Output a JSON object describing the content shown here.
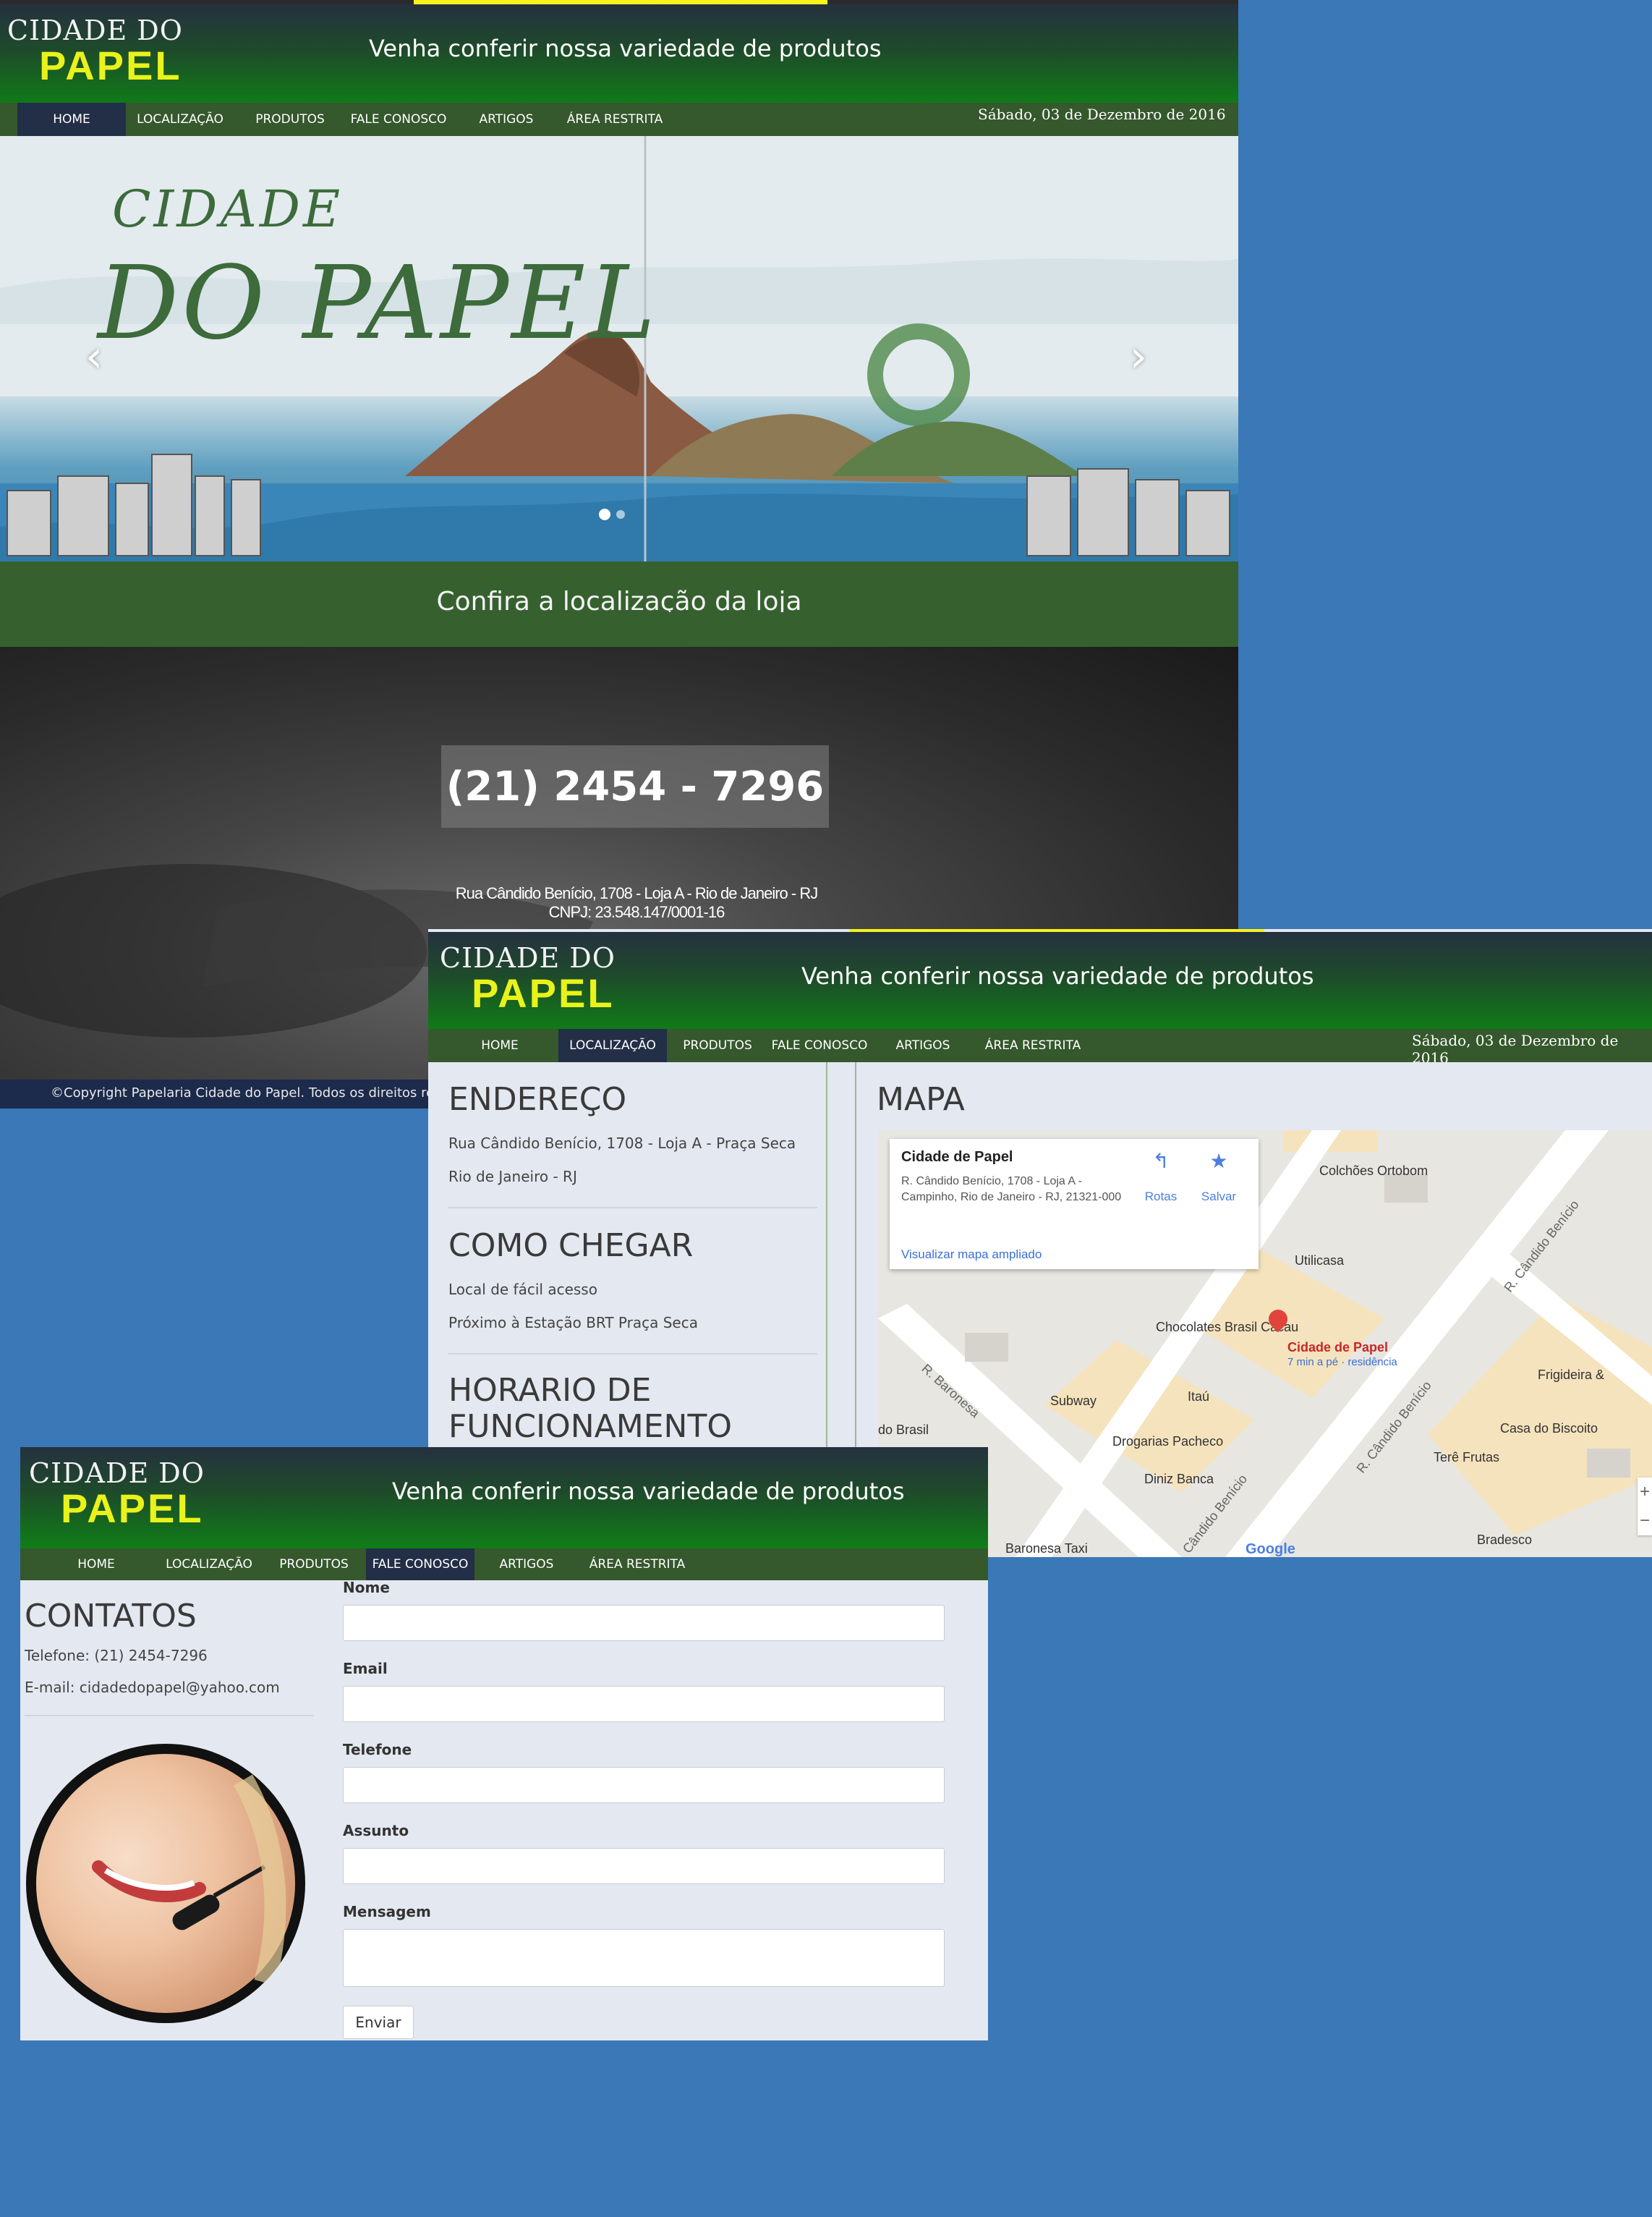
{
  "common": {
    "logo_line1": "CIDADE DO",
    "logo_line2": "PAPEL",
    "tagline": "Venha conferir nossa variedade de produtos",
    "date": "Sábado, 03 de Dezembro de 2016",
    "nav": [
      "HOME",
      "LOCALIZAÇÃO",
      "PRODUTOS",
      "FALE CONOSCO",
      "ARTIGOS",
      "ÁREA RESTRITA"
    ]
  },
  "home": {
    "hero_title_line1": "CIDADE",
    "hero_title_line2": "DO PAPEL",
    "prev_arrow": "‹",
    "next_arrow": "›",
    "location_banner": "Confira a localização da loja",
    "phone": "(21) 2454 - 7296",
    "address": "Rua Cândido Benício, 1708 - Loja A - Rio de Janeiro - RJ",
    "cnpj": "CNPJ: 23.548.147/0001-16",
    "copyright": "©Copyright Papelaria Cidade do Papel. Todos os direitos reser"
  },
  "location": {
    "endereco_title": "ENDEREÇO",
    "endereco_lines": [
      "Rua Cândido Benício, 1708 - Loja A - Praça Seca",
      "Rio de Janeiro - RJ"
    ],
    "chegar_title": "COMO CHEGAR",
    "chegar_lines": [
      "Local de fácil acesso",
      "Próximo à Estação BRT Praça Seca"
    ],
    "horario_title_line1": "HORARIO DE",
    "horario_title_line2": "FUNCIONAMENTO",
    "mapa_title": "MAPA",
    "map": {
      "place_name": "Cidade de Papel",
      "place_address": "R. Cândido Benício, 1708 - Loja A - Campinho, Rio de Janeiro - RJ, 21321-000",
      "directions": "Rotas",
      "save": "Salvar",
      "larger_map": "Visualizar mapa ampliado",
      "marker_label": "Cidade de Papel",
      "marker_sublabel": "7 min a pé · residência",
      "pois": [
        "Colchões Ortobom",
        "Utilicasa",
        "Chocolates Brasil Cacau",
        "Frigideira &",
        "Itaú",
        "Subway",
        "Drogarias Pacheco",
        "Diniz Banca",
        "Casa do Biscoito",
        "Terê Frutas",
        "Bradesco",
        "Baronesa Taxi",
        "do Brasil"
      ],
      "streets": [
        "R. Cândido Benício",
        "R. Cândido Benício",
        "R. Baronesa",
        "Cândido Benício"
      ],
      "zoom_in": "+",
      "zoom_out": "−",
      "google": "Google"
    }
  },
  "contact": {
    "title": "CONTATOS",
    "phone": "Telefone: (21) 2454-7296",
    "email": "E-mail: cidadedopapel@yahoo.com",
    "labels": {
      "name": "Nome",
      "email": "Email",
      "phone": "Telefone",
      "subject": "Assunto",
      "message": "Mensagem"
    },
    "submit": "Enviar"
  }
}
